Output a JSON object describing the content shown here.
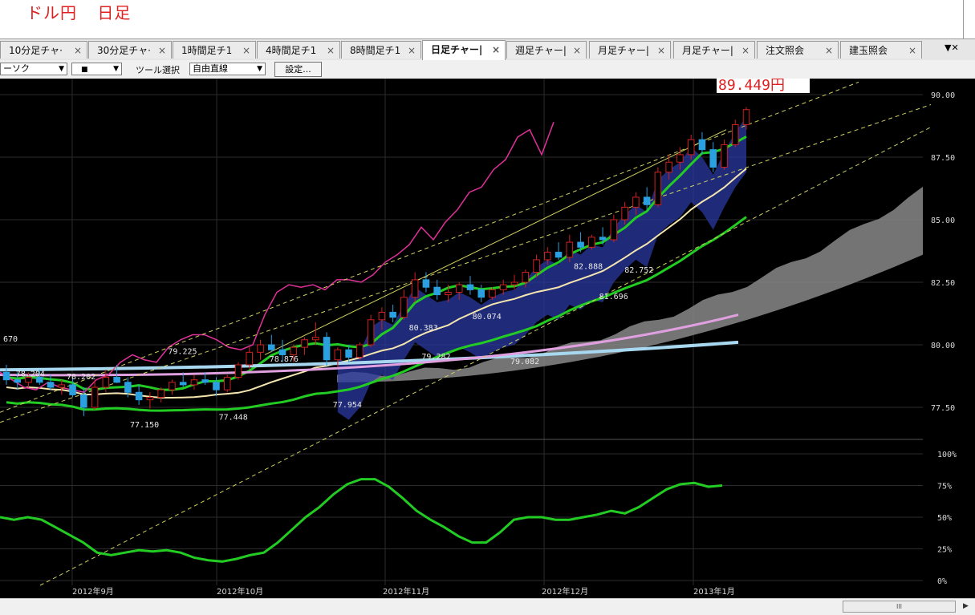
{
  "window": {
    "title": [
      "ドル円",
      "日足"
    ]
  },
  "tabs": [
    {
      "label": "10分足チャ·",
      "active": false
    },
    {
      "label": "30分足チャ·",
      "active": false
    },
    {
      "label": "1時間足チ1",
      "active": false
    },
    {
      "label": "4時間足チ1",
      "active": false
    },
    {
      "label": "8時間足チ1",
      "active": false
    },
    {
      "label": "日足チャー|",
      "active": true
    },
    {
      "label": "週足チャー|",
      "active": false
    },
    {
      "label": "月足チャー|",
      "active": false
    },
    {
      "label": "月足チャー|",
      "active": false
    },
    {
      "label": "注文照会",
      "active": false
    },
    {
      "label": "建玉照会",
      "active": false
    }
  ],
  "tab_close_glyph": "×",
  "tab_menu_glyph": "▼✕",
  "toolbar": {
    "chart_type_value": "ーソク",
    "color_value": "■",
    "tool_label": "ツール選択",
    "tool_value": "自由直線",
    "settings_label": "設定..."
  },
  "colors": {
    "bg": "#000000",
    "candle_up": "#d02020",
    "candle_down": "#2aa0e0",
    "ma_green": "#22cc22",
    "ma_cream": "#f5e6b0",
    "ma_pink": "#e0a0e0",
    "ma_lightblue": "#a8d8f0",
    "rci_magenta": "#e0309a",
    "cloud": "#888888",
    "band": "#2a3aa0",
    "trend": "#d0d060",
    "price_label": "#e02020"
  },
  "chart_data": {
    "type": "candlestick",
    "symbol_title": "ドル円 日足",
    "current_price_label": "89.449円",
    "ylim": [
      76.0,
      91.0
    ],
    "y_ticks": [
      "90.00",
      "87.50",
      "85.00",
      "82.50",
      "80.00",
      "77.50"
    ],
    "y_tick_values": [
      90.0,
      87.5,
      85.0,
      82.5,
      80.0,
      77.5
    ],
    "x_labels": [
      "2012年9月",
      "2012年10月",
      "2012年11月",
      "2012年12月",
      "2013年1月"
    ],
    "annotations": [
      {
        "text": "670",
        "x": "2012-08-22",
        "y": 80.0
      },
      {
        "text": "78.204",
        "x": "2012-08-23",
        "y": 78.6
      },
      {
        "text": "78.202",
        "x": "2012-09-04",
        "y": 78.5
      },
      {
        "text": "77.150",
        "x": "2012-09-13",
        "y": 77.15
      },
      {
        "text": "79.225",
        "x": "2012-09-20",
        "y": 79.5
      },
      {
        "text": "77.448",
        "x": "2012-09-26",
        "y": 77.45
      },
      {
        "text": "78.876",
        "x": "2012-10-04",
        "y": 79.2
      },
      {
        "text": "77.954",
        "x": "2012-10-11",
        "y": 77.95
      },
      {
        "text": "80.383",
        "x": "2012-10-23",
        "y": 80.45
      },
      {
        "text": "79.282",
        "x": "2012-10-25",
        "y": 79.3
      },
      {
        "text": "80.074",
        "x": "2012-10-31",
        "y": 80.9
      },
      {
        "text": "79.082",
        "x": "2012-11-05",
        "y": 79.1
      },
      {
        "text": "82.888",
        "x": "2012-11-22",
        "y": 82.9
      },
      {
        "text": "82.752",
        "x": "2012-11-30",
        "y": 82.75
      },
      {
        "text": "81.696",
        "x": "2012-11-29",
        "y": 81.7
      }
    ],
    "candles_approx": [
      {
        "o": 78.9,
        "h": 79.2,
        "l": 78.4,
        "c": 78.6
      },
      {
        "o": 78.6,
        "h": 78.9,
        "l": 78.2,
        "c": 78.5
      },
      {
        "o": 78.5,
        "h": 78.9,
        "l": 78.3,
        "c": 78.7
      },
      {
        "o": 78.7,
        "h": 79.0,
        "l": 78.4,
        "c": 78.5
      },
      {
        "o": 78.5,
        "h": 78.8,
        "l": 78.2,
        "c": 78.3
      },
      {
        "o": 78.3,
        "h": 78.6,
        "l": 78.0,
        "c": 78.4
      },
      {
        "o": 78.4,
        "h": 78.7,
        "l": 77.9,
        "c": 78.0
      },
      {
        "o": 78.0,
        "h": 78.3,
        "l": 77.15,
        "c": 77.5
      },
      {
        "o": 77.5,
        "h": 78.6,
        "l": 77.4,
        "c": 78.3
      },
      {
        "o": 78.3,
        "h": 79.0,
        "l": 78.1,
        "c": 78.7
      },
      {
        "o": 78.7,
        "h": 79.2,
        "l": 78.5,
        "c": 78.5
      },
      {
        "o": 78.5,
        "h": 78.7,
        "l": 77.9,
        "c": 78.1
      },
      {
        "o": 78.1,
        "h": 78.4,
        "l": 77.6,
        "c": 77.8
      },
      {
        "o": 77.8,
        "h": 78.1,
        "l": 77.45,
        "c": 77.9
      },
      {
        "o": 77.9,
        "h": 78.3,
        "l": 77.7,
        "c": 78.2
      },
      {
        "o": 78.2,
        "h": 78.6,
        "l": 78.0,
        "c": 78.5
      },
      {
        "o": 78.5,
        "h": 78.9,
        "l": 78.3,
        "c": 78.4
      },
      {
        "o": 78.4,
        "h": 78.8,
        "l": 78.2,
        "c": 78.6
      },
      {
        "o": 78.6,
        "h": 78.9,
        "l": 78.4,
        "c": 78.5
      },
      {
        "o": 78.5,
        "h": 78.7,
        "l": 77.95,
        "c": 78.2
      },
      {
        "o": 78.2,
        "h": 78.8,
        "l": 78.1,
        "c": 78.7
      },
      {
        "o": 78.7,
        "h": 79.3,
        "l": 78.6,
        "c": 79.2
      },
      {
        "o": 79.2,
        "h": 79.9,
        "l": 79.0,
        "c": 79.7
      },
      {
        "o": 79.7,
        "h": 80.2,
        "l": 79.4,
        "c": 80.0
      },
      {
        "o": 80.0,
        "h": 80.4,
        "l": 79.7,
        "c": 79.8
      },
      {
        "o": 79.8,
        "h": 80.2,
        "l": 79.3,
        "c": 79.6
      },
      {
        "o": 79.6,
        "h": 80.0,
        "l": 79.3,
        "c": 79.9
      },
      {
        "o": 79.9,
        "h": 80.3,
        "l": 79.6,
        "c": 80.2
      },
      {
        "o": 80.2,
        "h": 80.9,
        "l": 80.0,
        "c": 80.3
      },
      {
        "o": 80.3,
        "h": 80.5,
        "l": 79.1,
        "c": 79.4
      },
      {
        "o": 79.4,
        "h": 79.9,
        "l": 79.1,
        "c": 79.8
      },
      {
        "o": 79.8,
        "h": 80.0,
        "l": 79.3,
        "c": 79.5
      },
      {
        "o": 79.5,
        "h": 80.1,
        "l": 79.4,
        "c": 80.0
      },
      {
        "o": 80.0,
        "h": 81.2,
        "l": 79.9,
        "c": 81.0
      },
      {
        "o": 81.0,
        "h": 81.5,
        "l": 80.6,
        "c": 81.3
      },
      {
        "o": 81.3,
        "h": 81.6,
        "l": 80.9,
        "c": 81.1
      },
      {
        "o": 81.1,
        "h": 82.2,
        "l": 81.0,
        "c": 81.9
      },
      {
        "o": 81.9,
        "h": 82.9,
        "l": 81.7,
        "c": 82.6
      },
      {
        "o": 82.6,
        "h": 82.9,
        "l": 82.1,
        "c": 82.3
      },
      {
        "o": 82.3,
        "h": 82.6,
        "l": 81.8,
        "c": 82.0
      },
      {
        "o": 82.0,
        "h": 82.4,
        "l": 81.7,
        "c": 82.1
      },
      {
        "o": 82.1,
        "h": 82.5,
        "l": 81.8,
        "c": 82.4
      },
      {
        "o": 82.4,
        "h": 82.75,
        "l": 82.0,
        "c": 82.2
      },
      {
        "o": 82.2,
        "h": 82.4,
        "l": 81.7,
        "c": 81.9
      },
      {
        "o": 81.9,
        "h": 82.3,
        "l": 81.8,
        "c": 82.2
      },
      {
        "o": 82.2,
        "h": 82.6,
        "l": 82.0,
        "c": 82.4
      },
      {
        "o": 82.4,
        "h": 82.8,
        "l": 82.2,
        "c": 82.5
      },
      {
        "o": 82.5,
        "h": 83.0,
        "l": 82.3,
        "c": 82.9
      },
      {
        "o": 82.9,
        "h": 83.6,
        "l": 82.7,
        "c": 83.4
      },
      {
        "o": 83.4,
        "h": 83.9,
        "l": 83.2,
        "c": 83.7
      },
      {
        "o": 83.7,
        "h": 84.1,
        "l": 83.4,
        "c": 83.5
      },
      {
        "o": 83.5,
        "h": 84.4,
        "l": 83.3,
        "c": 84.1
      },
      {
        "o": 84.1,
        "h": 84.5,
        "l": 83.7,
        "c": 83.9
      },
      {
        "o": 83.9,
        "h": 84.4,
        "l": 83.8,
        "c": 84.3
      },
      {
        "o": 84.3,
        "h": 84.7,
        "l": 84.0,
        "c": 84.2
      },
      {
        "o": 84.2,
        "h": 85.2,
        "l": 84.1,
        "c": 85.0
      },
      {
        "o": 85.0,
        "h": 85.7,
        "l": 84.8,
        "c": 85.5
      },
      {
        "o": 85.5,
        "h": 86.1,
        "l": 85.2,
        "c": 85.9
      },
      {
        "o": 85.9,
        "h": 86.3,
        "l": 85.4,
        "c": 85.6
      },
      {
        "o": 85.6,
        "h": 87.1,
        "l": 85.5,
        "c": 86.9
      },
      {
        "o": 86.9,
        "h": 87.6,
        "l": 86.6,
        "c": 87.3
      },
      {
        "o": 87.3,
        "h": 87.9,
        "l": 87.0,
        "c": 87.6
      },
      {
        "o": 87.6,
        "h": 88.4,
        "l": 87.4,
        "c": 88.2
      },
      {
        "o": 88.2,
        "h": 88.5,
        "l": 87.6,
        "c": 87.8
      },
      {
        "o": 87.8,
        "h": 88.1,
        "l": 86.9,
        "c": 87.1
      },
      {
        "o": 87.1,
        "h": 88.2,
        "l": 87.0,
        "c": 88.0
      },
      {
        "o": 88.0,
        "h": 89.0,
        "l": 87.9,
        "c": 88.8
      },
      {
        "o": 88.8,
        "h": 89.5,
        "l": 88.6,
        "c": 89.4
      }
    ],
    "oscillator": {
      "y_ticks": [
        "100%",
        "75%",
        "50%",
        "25%",
        "0%"
      ],
      "y_tick_values": [
        100,
        75,
        50,
        25,
        0
      ],
      "values_approx": [
        50,
        48,
        50,
        48,
        42,
        36,
        30,
        22,
        20,
        22,
        24,
        23,
        24,
        22,
        18,
        16,
        15,
        17,
        20,
        22,
        30,
        40,
        50,
        58,
        68,
        76,
        80,
        80,
        74,
        65,
        55,
        48,
        42,
        35,
        30,
        30,
        38,
        48,
        50,
        50,
        48,
        48,
        50,
        52,
        55,
        53,
        58,
        65,
        72,
        76,
        77,
        74,
        75
      ]
    }
  }
}
